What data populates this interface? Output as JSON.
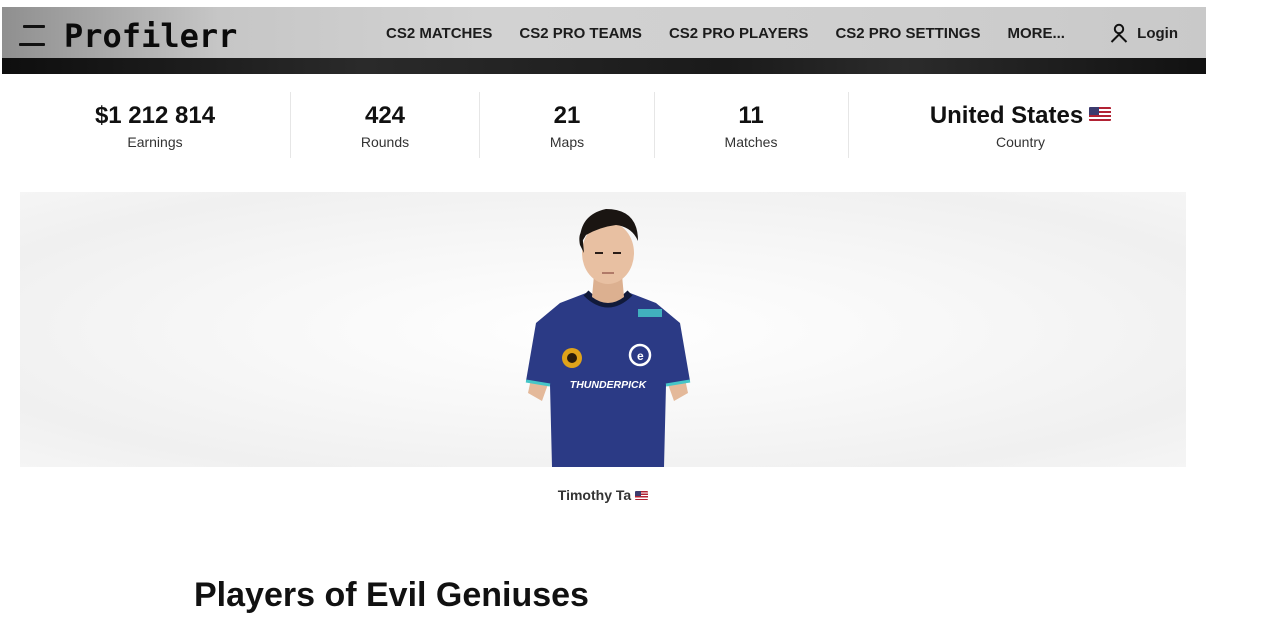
{
  "header": {
    "logo": "Profilerr",
    "nav": [
      "CS2 MATCHES",
      "CS2 PRO TEAMS",
      "CS2 PRO PLAYERS",
      "CS2 PRO SETTINGS",
      "MORE..."
    ],
    "login_label": "Login",
    "icons": {
      "menu": "hamburger-menu-icon",
      "login": "user-icon"
    }
  },
  "stats": [
    {
      "value": "$1 212 814",
      "label": "Earnings"
    },
    {
      "value": "424",
      "label": "Rounds"
    },
    {
      "value": "21",
      "label": "Maps"
    },
    {
      "value": "11",
      "label": "Matches"
    },
    {
      "value": "United States",
      "label": "Country",
      "flag": "us-flag-icon"
    }
  ],
  "player": {
    "name": "Timothy Ta",
    "flag": "us-flag-icon",
    "jersey_text": "THUNDERPICK"
  },
  "section": {
    "title": "Players of Evil Geniuses"
  },
  "colors": {
    "jersey": "#2b3a85",
    "header_dark": "#1b1b1b",
    "accent_cyan": "#45c6c8"
  }
}
